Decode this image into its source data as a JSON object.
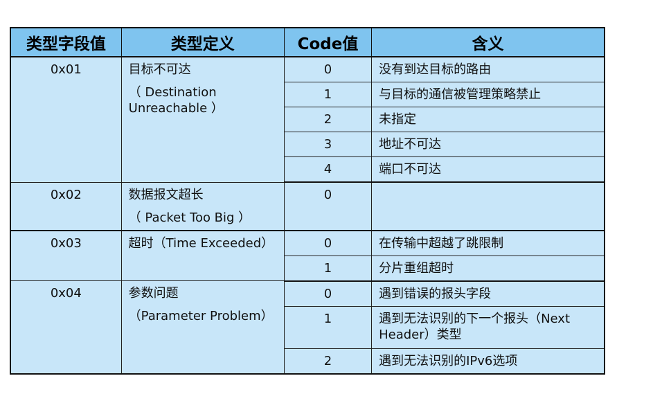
{
  "table": {
    "headers": [
      "类型字段值",
      "类型定义",
      "Code值",
      "含义"
    ],
    "groups": [
      {
        "type_value": "0x01",
        "definition_cn": "目标不可达",
        "definition_en": "（ Destination Unreachable ）",
        "codes": [
          {
            "code": "0",
            "meaning": "没有到达目标的路由"
          },
          {
            "code": "1",
            "meaning": "与目标的通信被管理策略禁止"
          },
          {
            "code": "2",
            "meaning": "未指定"
          },
          {
            "code": "3",
            "meaning": "地址不可达"
          },
          {
            "code": "4",
            "meaning": "端口不可达"
          }
        ]
      },
      {
        "type_value": "0x02",
        "definition_cn": "数据报文超长",
        "definition_en": "（ Packet Too Big ）",
        "codes": [
          {
            "code": "0",
            "meaning": ""
          }
        ]
      },
      {
        "type_value": "0x03",
        "definition_cn": "超时（Time Exceeded）",
        "definition_en": "",
        "codes": [
          {
            "code": "0",
            "meaning": "在传输中超越了跳限制"
          },
          {
            "code": "1",
            "meaning": "分片重组超时"
          }
        ]
      },
      {
        "type_value": "0x04",
        "definition_cn": "参数问题",
        "definition_en": "（Parameter Problem）",
        "codes": [
          {
            "code": "0",
            "meaning": "遇到错误的报头字段"
          },
          {
            "code": "1",
            "meaning": "遇到无法识别的下一个报头（Next Header）类型"
          },
          {
            "code": "2",
            "meaning": "遇到无法识别的IPv6选项"
          }
        ]
      }
    ]
  }
}
